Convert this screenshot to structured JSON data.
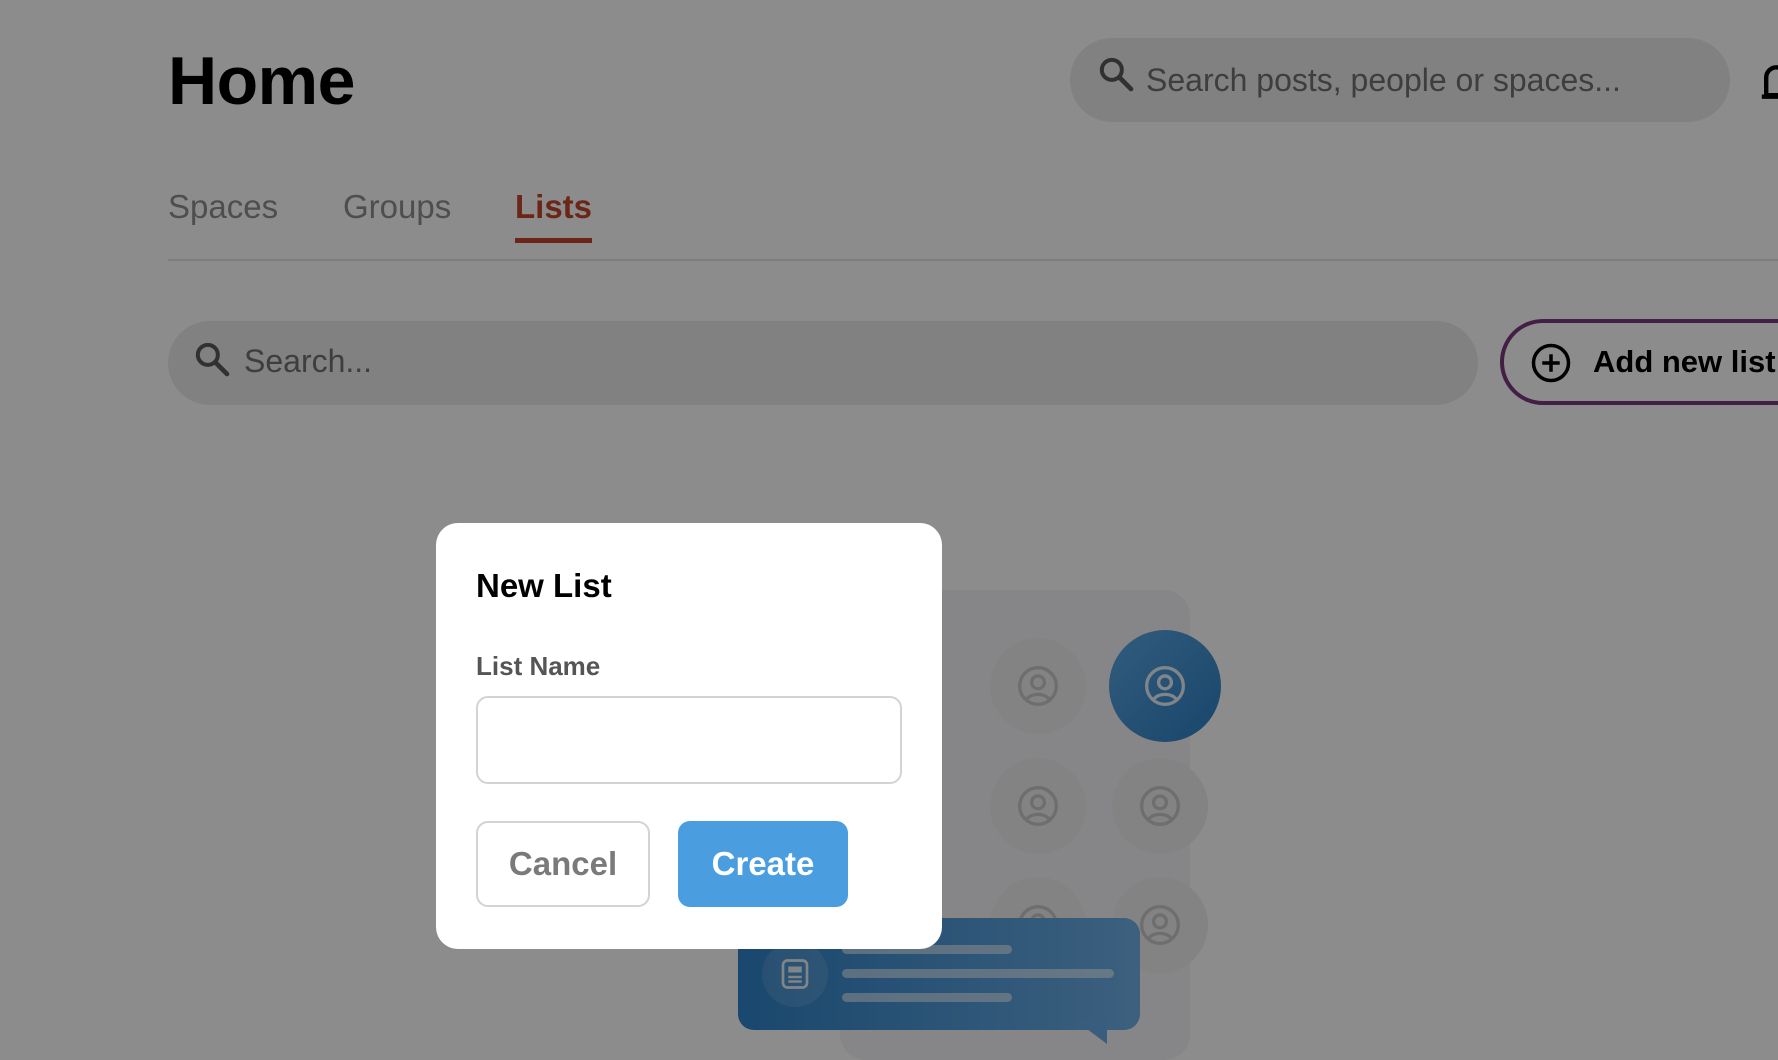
{
  "header": {
    "title": "Home",
    "search_placeholder": "Search posts, people or spaces..."
  },
  "tabs": [
    {
      "label": "Spaces",
      "active": false
    },
    {
      "label": "Groups",
      "active": false
    },
    {
      "label": "Lists",
      "active": true
    }
  ],
  "toolbar": {
    "search_placeholder": "Search...",
    "add_list_label": "Add new list"
  },
  "modal": {
    "title": "New List",
    "field_label": "List Name",
    "field_value": "",
    "cancel_label": "Cancel",
    "create_label": "Create"
  },
  "colors": {
    "accent_tab": "#c4462a",
    "primary_button": "#4a9ee0",
    "add_button_border": "#7b3a80"
  }
}
